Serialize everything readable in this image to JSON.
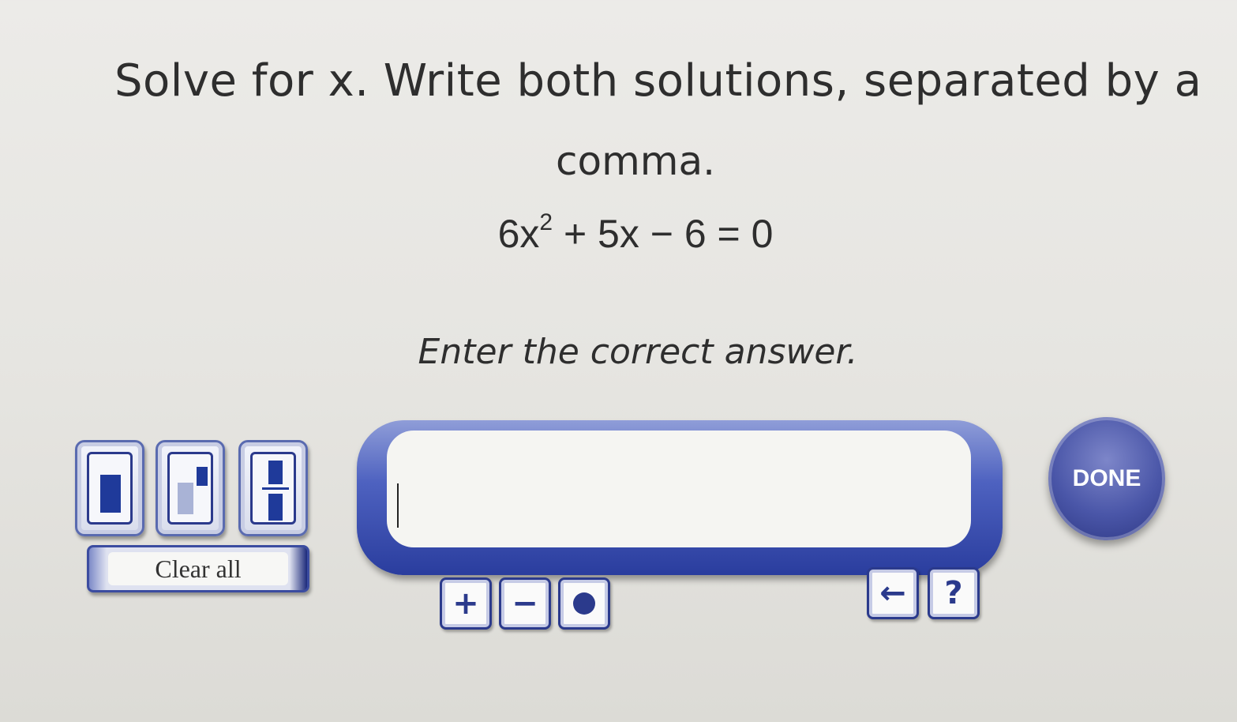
{
  "question": {
    "line1": "Solve for x. Write both solutions, separated by a",
    "line2": "comma.",
    "equation": {
      "coefficient": "6x",
      "exponent": "2",
      "rest": " + 5x − 6 = 0"
    },
    "prompt": "Enter the correct answer."
  },
  "answer": {
    "value": ""
  },
  "buttons": {
    "clear_all": "Clear all",
    "done": "DONE",
    "help": "?",
    "backspace": "←",
    "plus": "+",
    "minus": "−"
  },
  "templates": [
    "box-template-icon",
    "superscript-template-icon",
    "fraction-template-icon"
  ],
  "colors": {
    "accent": "#2b3a8c",
    "input_frame": "#4e62c0",
    "done_button": "#4a56a8"
  }
}
